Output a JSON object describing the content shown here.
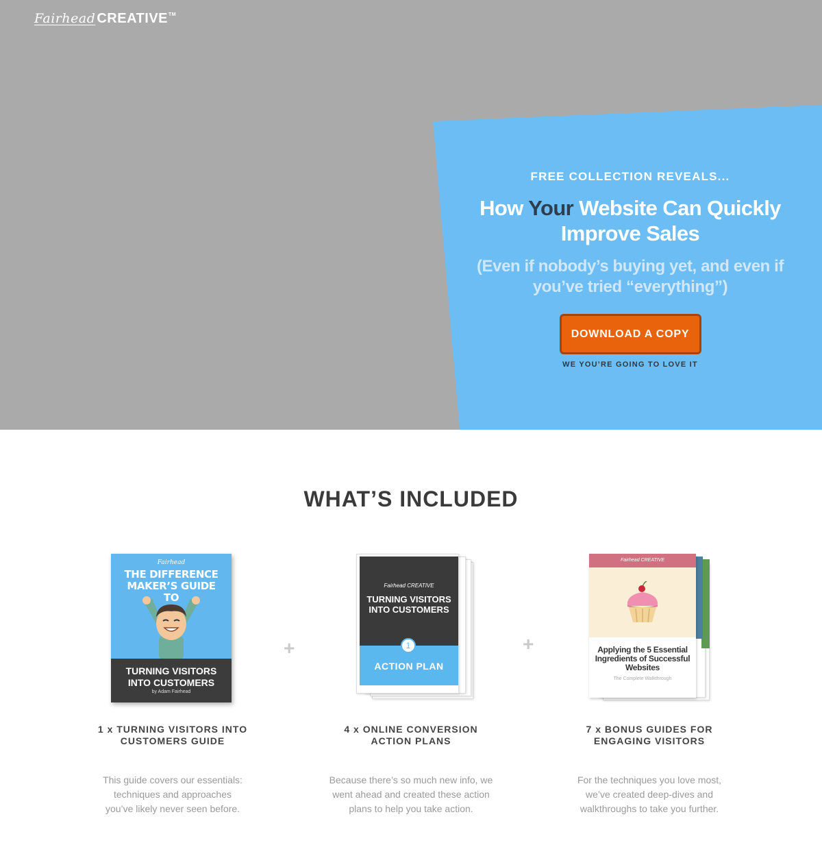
{
  "brand": {
    "logo_script": "Fairhead",
    "logo_word": "CREATIVE",
    "logo_tm": "TM"
  },
  "hero": {
    "eyebrow": "FREE COLLECTION REVEALS...",
    "headline_pre": "How ",
    "headline_emphasis": "Your",
    "headline_post": " Website Can Quickly Improve Sales",
    "subhead": "(Even if nobody’s buying yet, and even if you’ve tried “everything”)",
    "cta_label": "DOWNLOAD A COPY",
    "cta_note": "WE YOU’RE GOING TO LOVE IT",
    "colors": {
      "background": "#aaaaaa",
      "panel": "#6bbdf3",
      "cta": "#e9620c"
    }
  },
  "included": {
    "title": "WHAT’S INCLUDED",
    "plus": "+",
    "items": [
      {
        "heading": "1 x TURNING VISITORS INTO CUSTOMERS GUIDE",
        "description": "This guide covers our essentials: techniques and approaches you’ve likely never seen before.",
        "cover": {
          "logo": "Fairhead",
          "title_top": "THE DIFFERENCE MAKER’S GUIDE TO",
          "title_bottom": "TURNING VISITORS INTO CUSTOMERS",
          "author": "by Adam Fairhead"
        }
      },
      {
        "heading": "4 x ONLINE CONVERSION ACTION PLANS",
        "description": "Because there’s so much new info, we went ahead and created these action plans to help you take action.",
        "cover": {
          "logo": "Fairhead CREATIVE",
          "title": "TURNING VISITORS INTO CUSTOMERS",
          "number": "1",
          "label": "ACTION PLAN"
        }
      },
      {
        "heading": "7 x BONUS GUIDES FOR ENGAGING VISITORS",
        "description": "For the techniques you love most, we’ve created deep-dives and walkthroughs to take you further.",
        "cover": {
          "logo": "Fairhead CREATIVE",
          "title": "Applying the 5 Essential Ingredients of Successful Websites",
          "subtitle": "The Complete Walkthrough"
        }
      }
    ]
  }
}
